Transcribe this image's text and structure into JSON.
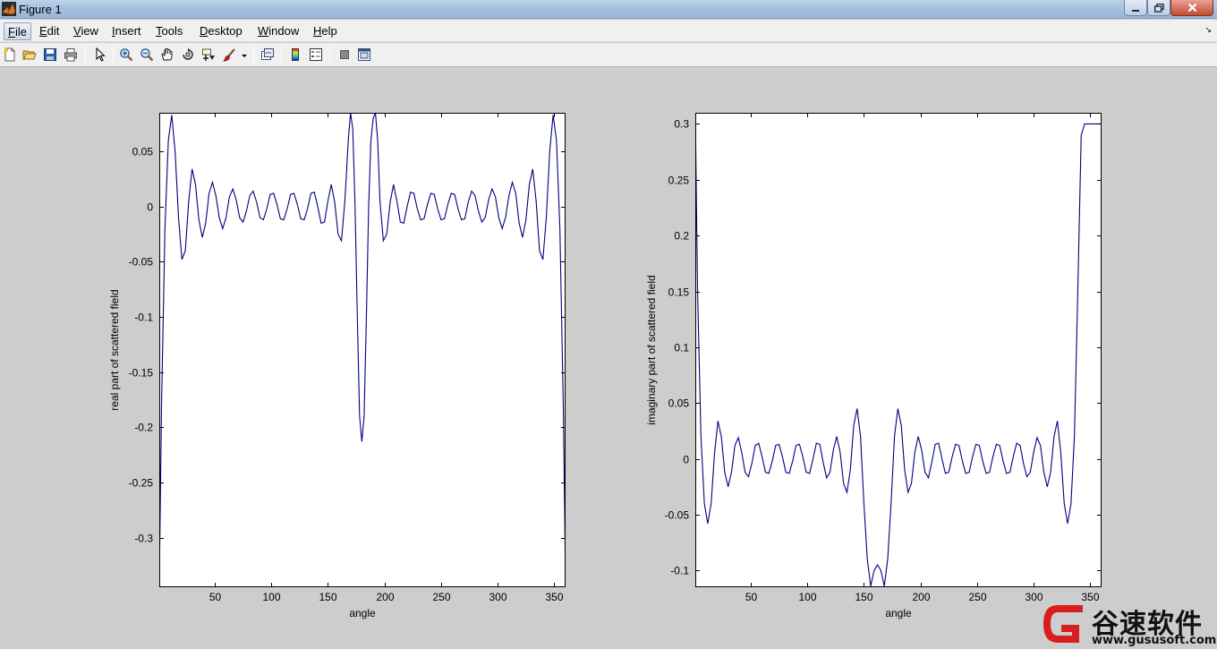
{
  "window": {
    "title": "Figure 1",
    "blurred_title": "(blurred text)"
  },
  "menu": {
    "items": [
      {
        "label": "File",
        "accel": "F",
        "rest": "ile"
      },
      {
        "label": "Edit",
        "accel": "E",
        "rest": "dit"
      },
      {
        "label": "View",
        "accel": "V",
        "rest": "iew"
      },
      {
        "label": "Insert",
        "accel": "I",
        "rest": "nsert"
      },
      {
        "label": "Tools",
        "accel": "T",
        "rest": "ools"
      },
      {
        "label": "Desktop",
        "accel": "D",
        "rest": "esktop"
      },
      {
        "label": "Window",
        "accel": "W",
        "rest": "indow"
      },
      {
        "label": "Help",
        "accel": "H",
        "rest": "elp"
      }
    ]
  },
  "toolbar": {
    "icons": [
      "new-figure-icon",
      "open-file-icon",
      "save-icon",
      "print-icon",
      "edit-plot-arrow-icon",
      "zoom-in-icon",
      "zoom-out-icon",
      "pan-hand-icon",
      "rotate-3d-icon",
      "data-cursor-icon",
      "brush-icon",
      "link-plot-icon",
      "colorbar-icon",
      "legend-icon",
      "hide-plot-tools-icon",
      "show-plot-tools-icon"
    ]
  },
  "chart_data": [
    {
      "type": "line",
      "title": "",
      "xlabel": "angle",
      "ylabel": "real part of scattered field",
      "xlim": [
        1,
        360
      ],
      "ylim": [
        -0.345,
        0.085
      ],
      "xticks": [
        50,
        100,
        150,
        200,
        250,
        300,
        350
      ],
      "yticks": [
        0.05,
        0,
        -0.05,
        -0.1,
        -0.15,
        -0.2,
        -0.25,
        -0.3
      ],
      "ytick_labels": [
        "0.05",
        "0",
        "-0.05",
        "-0.1",
        "-0.15",
        "-0.2",
        "-0.25",
        "-0.3"
      ],
      "line_color": "#00007f",
      "series": [
        {
          "x": [
            1,
            3,
            6,
            9,
            12,
            15,
            18,
            21,
            24,
            27,
            30,
            33,
            36,
            39,
            42,
            45,
            48,
            51,
            54,
            57,
            60,
            63,
            66,
            69,
            72,
            75,
            78,
            81,
            84,
            87,
            90,
            93,
            96,
            99,
            102,
            105,
            108,
            111,
            114,
            117,
            120,
            123,
            126,
            129,
            132,
            135,
            138,
            141,
            144,
            147,
            150,
            153,
            156,
            159,
            162,
            165,
            168,
            170,
            172,
            174,
            176,
            178,
            180,
            182,
            184,
            186,
            188,
            190,
            192,
            194,
            196,
            199,
            202,
            205,
            208,
            211,
            214,
            217,
            220,
            223,
            226,
            229,
            232,
            235,
            238,
            241,
            244,
            247,
            250,
            253,
            256,
            259,
            262,
            265,
            268,
            271,
            274,
            277,
            280,
            283,
            286,
            289,
            292,
            295,
            298,
            301,
            304,
            307,
            310,
            313,
            316,
            319,
            322,
            325,
            328,
            331,
            334,
            337,
            340,
            343,
            346,
            349,
            352,
            355,
            358,
            360
          ],
          "y": [
            -0.34,
            -0.18,
            -0.02,
            0.06,
            0.083,
            0.05,
            -0.01,
            -0.048,
            -0.04,
            0.005,
            0.034,
            0.02,
            -0.012,
            -0.028,
            -0.015,
            0.012,
            0.022,
            0.01,
            -0.01,
            -0.02,
            -0.01,
            0.009,
            0.016,
            0.006,
            -0.01,
            -0.014,
            -0.004,
            0.01,
            0.014,
            0.004,
            -0.01,
            -0.012,
            -0.002,
            0.011,
            0.012,
            0.002,
            -0.011,
            -0.012,
            -0.002,
            0.011,
            0.012,
            0.002,
            -0.011,
            -0.012,
            -0.002,
            0.012,
            0.013,
            0.0,
            -0.015,
            -0.014,
            0.005,
            0.02,
            0.004,
            -0.025,
            -0.031,
            0.005,
            0.06,
            0.085,
            0.07,
            0.0,
            -0.1,
            -0.19,
            -0.213,
            -0.19,
            -0.1,
            0.0,
            0.06,
            0.08,
            0.085,
            0.06,
            0.005,
            -0.031,
            -0.025,
            0.004,
            0.02,
            0.005,
            -0.014,
            -0.015,
            0.0,
            0.013,
            0.012,
            -0.002,
            -0.012,
            -0.011,
            0.002,
            0.012,
            0.011,
            -0.002,
            -0.012,
            -0.011,
            0.002,
            0.012,
            0.011,
            -0.002,
            -0.012,
            -0.011,
            0.004,
            0.014,
            0.01,
            -0.004,
            -0.014,
            -0.01,
            0.006,
            0.016,
            0.009,
            -0.01,
            -0.02,
            -0.01,
            0.01,
            0.022,
            0.012,
            -0.015,
            -0.028,
            -0.012,
            0.02,
            0.034,
            0.005,
            -0.04,
            -0.048,
            -0.01,
            0.05,
            0.083,
            0.06,
            -0.02,
            -0.18,
            -0.34
          ]
        }
      ]
    },
    {
      "type": "line",
      "title": "",
      "xlabel": "angle",
      "ylabel": "imaginary part of scattered field",
      "xlim": [
        1,
        360
      ],
      "ylim": [
        -0.115,
        0.31
      ],
      "xticks": [
        50,
        100,
        150,
        200,
        250,
        300,
        350
      ],
      "yticks": [
        0.3,
        0.25,
        0.2,
        0.15,
        0.1,
        0.05,
        0,
        -0.05,
        -0.1
      ],
      "ytick_labels": [
        "0.3",
        "0.25",
        "0.2",
        "0.15",
        "0.1",
        "0.05",
        "0",
        "-0.05",
        "-0.1"
      ],
      "line_color": "#00007f",
      "series": [
        {
          "x": [
            1,
            3,
            6,
            9,
            12,
            15,
            18,
            21,
            24,
            27,
            30,
            33,
            36,
            39,
            42,
            45,
            48,
            51,
            54,
            57,
            60,
            63,
            66,
            69,
            72,
            75,
            78,
            81,
            84,
            87,
            90,
            93,
            96,
            99,
            102,
            105,
            108,
            111,
            114,
            117,
            120,
            123,
            126,
            129,
            132,
            135,
            138,
            141,
            144,
            147,
            150,
            153,
            156,
            159,
            162,
            165,
            168,
            171,
            174,
            177,
            180,
            183,
            186,
            189,
            192,
            195,
            198,
            201,
            204,
            207,
            210,
            213,
            216,
            219,
            222,
            225,
            228,
            231,
            234,
            237,
            240,
            243,
            246,
            249,
            252,
            255,
            258,
            261,
            264,
            267,
            270,
            273,
            276,
            279,
            282,
            285,
            288,
            291,
            294,
            297,
            300,
            303,
            306,
            309,
            312,
            315,
            318,
            321,
            324,
            327,
            330,
            333,
            336,
            339,
            342,
            345,
            348,
            351,
            354,
            357,
            360
          ],
          "y": [
            0.31,
            0.15,
            0.02,
            -0.04,
            -0.058,
            -0.04,
            0.005,
            0.034,
            0.02,
            -0.012,
            -0.025,
            -0.012,
            0.012,
            0.019,
            0.006,
            -0.012,
            -0.016,
            -0.004,
            0.012,
            0.014,
            0.002,
            -0.012,
            -0.013,
            -0.002,
            0.012,
            0.013,
            0.002,
            -0.012,
            -0.013,
            -0.002,
            0.012,
            0.013,
            0.002,
            -0.012,
            -0.013,
            0.0,
            0.014,
            0.013,
            -0.003,
            -0.017,
            -0.012,
            0.008,
            0.02,
            0.006,
            -0.022,
            -0.03,
            -0.01,
            0.03,
            0.045,
            0.02,
            -0.04,
            -0.09,
            -0.114,
            -0.1,
            -0.095,
            -0.1,
            -0.114,
            -0.09,
            -0.04,
            0.02,
            0.045,
            0.03,
            -0.01,
            -0.03,
            -0.022,
            0.006,
            0.02,
            0.008,
            -0.012,
            -0.017,
            -0.003,
            0.013,
            0.014,
            0.0,
            -0.013,
            -0.012,
            0.002,
            0.013,
            0.012,
            -0.002,
            -0.013,
            -0.012,
            0.002,
            0.013,
            0.012,
            -0.002,
            -0.013,
            -0.012,
            0.002,
            0.013,
            0.012,
            -0.002,
            -0.013,
            -0.012,
            0.002,
            0.014,
            0.012,
            -0.004,
            -0.016,
            -0.012,
            0.006,
            0.019,
            0.012,
            -0.012,
            -0.025,
            -0.012,
            0.02,
            0.034,
            0.005,
            -0.04,
            -0.058,
            -0.04,
            0.02,
            0.15,
            0.29,
            0.3,
            0.3,
            0.3,
            0.3,
            0.3,
            0.3
          ]
        }
      ]
    }
  ],
  "watermark": {
    "cn_text": "谷速软件",
    "url": "www.gususoft.com"
  }
}
